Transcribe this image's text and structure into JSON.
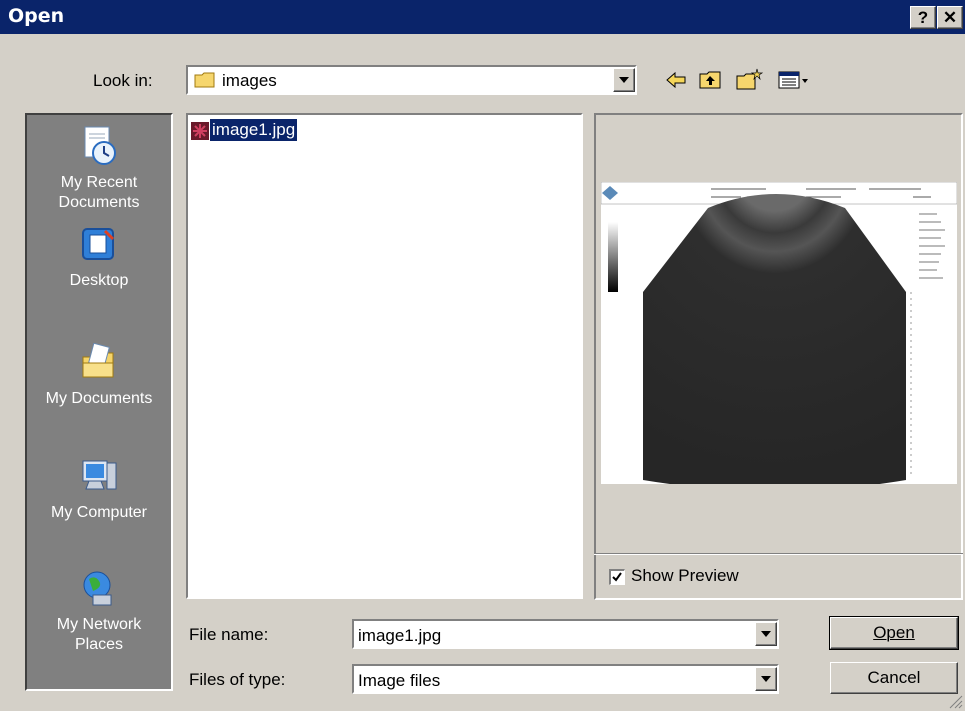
{
  "window": {
    "title": "Open"
  },
  "look_in": {
    "label": "Look in:",
    "value": "images"
  },
  "toolbar": {
    "back_icon": "back-arrow-icon",
    "up_icon": "up-folder-icon",
    "new_icon": "new-folder-icon",
    "view_icon": "view-menu-icon"
  },
  "places": [
    {
      "label_1": "My Recent",
      "label_2": "Documents",
      "icon": "recent-documents-icon"
    },
    {
      "label_1": "Desktop",
      "icon": "desktop-icon"
    },
    {
      "label_1": "My Documents",
      "icon": "my-documents-icon"
    },
    {
      "label_1": "My Computer",
      "icon": "my-computer-icon"
    },
    {
      "label_1": "My Network",
      "label_2": "Places",
      "icon": "network-places-icon"
    }
  ],
  "files": [
    {
      "name": "image1.jpg",
      "selected": true
    }
  ],
  "preview": {
    "show_label": "Show Preview",
    "checked": true
  },
  "file_name": {
    "label": "File name:",
    "value": "image1.jpg"
  },
  "file_type": {
    "label": "Files of type:",
    "value": "Image files"
  },
  "buttons": {
    "open": "Open",
    "cancel": "Cancel"
  },
  "colors": {
    "title_bar": "#0a246a",
    "face": "#d4d0c8",
    "selection": "#0a246a"
  }
}
